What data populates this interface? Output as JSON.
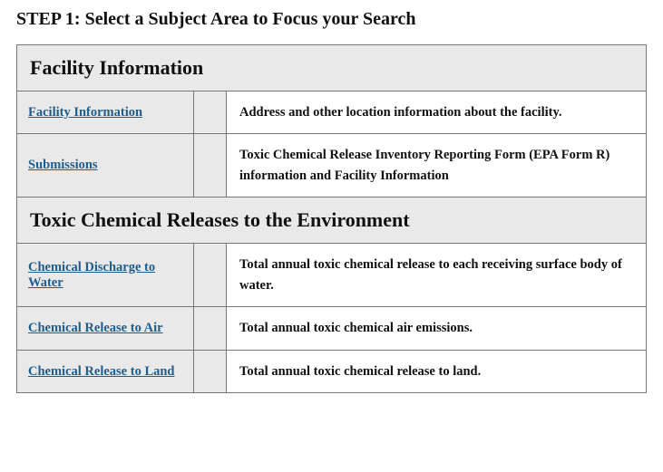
{
  "step_title": "STEP 1: Select a Subject Area to Focus your Search",
  "sections": {
    "facility": {
      "header": "Facility Information",
      "rows": [
        {
          "link": "Facility Information",
          "desc": "Address and other location information about the facility."
        },
        {
          "link": "Submissions",
          "desc": "Toxic Chemical Release Inventory Reporting Form (EPA Form R) information and Facility Information"
        }
      ]
    },
    "toxic": {
      "header": "Toxic Chemical Releases to the Environment",
      "rows": [
        {
          "link": "Chemical Discharge to Water",
          "desc": "Total annual toxic chemical release to each receiving surface body of water."
        },
        {
          "link": "Chemical Release to Air",
          "desc": "Total annual toxic chemical air emissions."
        },
        {
          "link": "Chemical Release to Land",
          "desc": "Total annual toxic chemical release to land."
        }
      ]
    }
  }
}
